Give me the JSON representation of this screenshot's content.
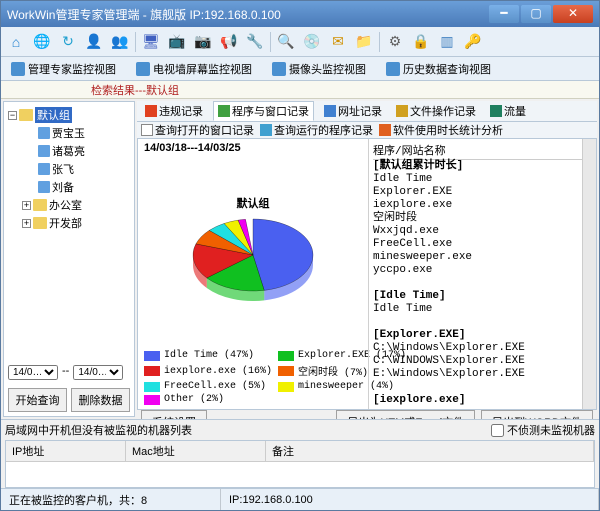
{
  "window_title": "WorkWin管理专家管理端 - 旗舰版 IP:192.168.0.100",
  "main_tabs": {
    "monitor": "管理专家监控视图",
    "tvwall": "电视墙屏幕监控视图",
    "camera": "摄像头监控视图",
    "history": "历史数据查询视图"
  },
  "search_result_label": "检索结果---默认组",
  "tree": {
    "root": "默认组",
    "items": [
      "贾宝玉",
      "诸葛亮",
      "张飞",
      "刘备"
    ],
    "groups": [
      "办公室",
      "开发部"
    ]
  },
  "date_from": "14/0…",
  "date_to": "14/0…",
  "date_sep": "--",
  "btn_start_query": "开始查询",
  "btn_del_data": "删除数据",
  "subtabs": {
    "violation": "违规记录",
    "program": "程序与窗口记录",
    "url": "网址记录",
    "file": "文件操作记录",
    "traffic": "流量"
  },
  "subbar": {
    "open_window": "查询打开的窗口记录",
    "running_prog": "查询运行的程序记录",
    "usage_stats": "软件使用时长统计分析"
  },
  "date_range": "14/03/18---14/03/25",
  "pie_title": "默认组",
  "list_header": "程序/网站名称",
  "list_title": "[默认组累计时长]",
  "list_items": [
    "Idle Time",
    "Explorer.EXE",
    "iexplore.exe",
    "空闲时段",
    "Wxxjqd.exe",
    "FreeCell.exe",
    "minesweeper.exe",
    "yccpo.exe"
  ],
  "detail_groups": [
    {
      "title": "[Idle Time]",
      "lines": [
        "Idle Time"
      ]
    },
    {
      "title": "[Explorer.EXE]",
      "lines": [
        "C:\\Windows\\Explorer.EXE",
        "C:\\WINDOWS\\Explorer.EXE",
        "E:\\Windows\\Explorer.EXE"
      ]
    },
    {
      "title": "[iexplore.exe]",
      "lines": []
    }
  ],
  "chart_data": {
    "type": "pie",
    "title": "默认组",
    "series": [
      {
        "name": "Idle Time",
        "pct": 47,
        "color": "#4a60f0"
      },
      {
        "name": "Explorer.EXE",
        "pct": 17,
        "color": "#10c020"
      },
      {
        "name": "iexplore.exe",
        "pct": 16,
        "color": "#e02020"
      },
      {
        "name": "空闲时段",
        "pct": 7,
        "color": "#f06000"
      },
      {
        "name": "FreeCell.exe",
        "pct": 5,
        "color": "#20e0e0"
      },
      {
        "name": "minesweeper",
        "pct": 4,
        "color": "#f0f000"
      },
      {
        "name": "Other",
        "pct": 2,
        "color": "#f000f0"
      }
    ]
  },
  "btn_settings": "系统设置",
  "btn_export_html": "导出为HTM或Excel文件",
  "btn_export_word": "导出到WORD文件",
  "bottom_label": "局域网中开机但没有被监视的机器列表",
  "chk_label": "不侦测未监视机器",
  "grid_cols": {
    "ip": "IP地址",
    "mac": "Mac地址",
    "remark": "备注"
  },
  "status_clients": "正在被监控的客户机，共：8",
  "status_ip": "IP:192.168.0.100"
}
